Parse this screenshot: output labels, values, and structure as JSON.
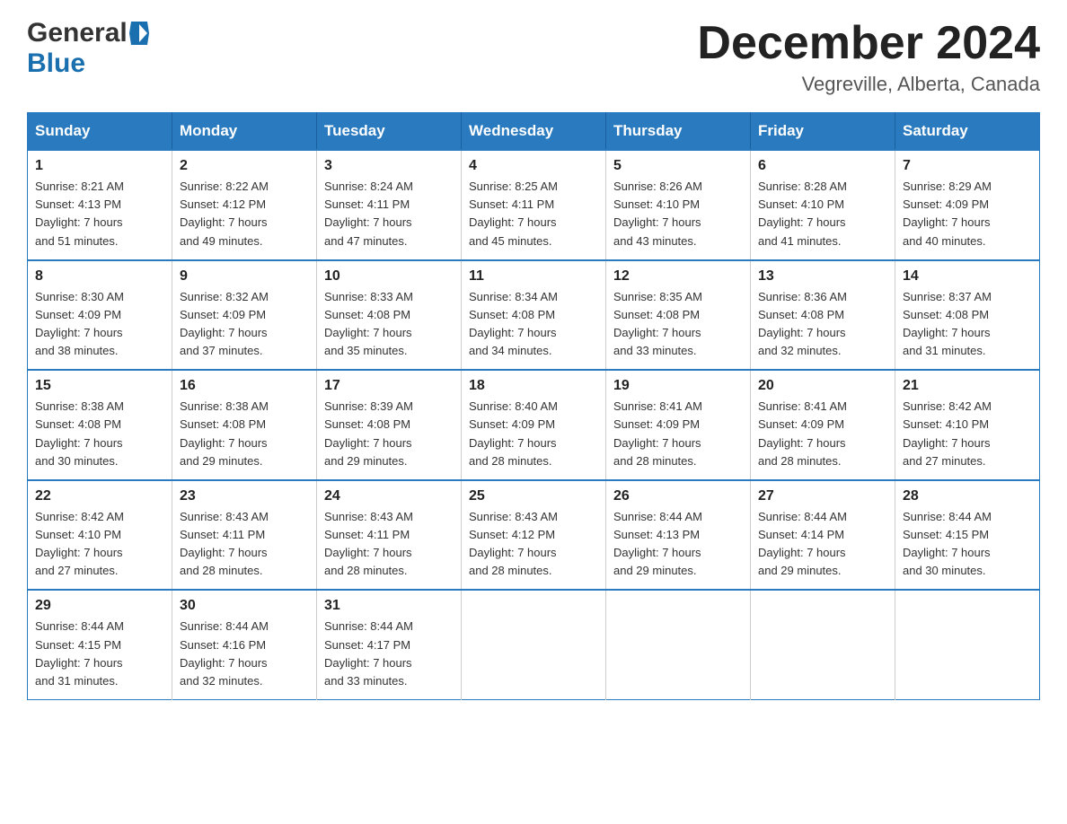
{
  "header": {
    "logo_general": "General",
    "logo_blue": "Blue",
    "month_title": "December 2024",
    "location": "Vegreville, Alberta, Canada"
  },
  "days_of_week": [
    "Sunday",
    "Monday",
    "Tuesday",
    "Wednesday",
    "Thursday",
    "Friday",
    "Saturday"
  ],
  "weeks": [
    [
      {
        "day": "1",
        "sunrise": "8:21 AM",
        "sunset": "4:13 PM",
        "daylight": "7 hours and 51 minutes."
      },
      {
        "day": "2",
        "sunrise": "8:22 AM",
        "sunset": "4:12 PM",
        "daylight": "7 hours and 49 minutes."
      },
      {
        "day": "3",
        "sunrise": "8:24 AM",
        "sunset": "4:11 PM",
        "daylight": "7 hours and 47 minutes."
      },
      {
        "day": "4",
        "sunrise": "8:25 AM",
        "sunset": "4:11 PM",
        "daylight": "7 hours and 45 minutes."
      },
      {
        "day": "5",
        "sunrise": "8:26 AM",
        "sunset": "4:10 PM",
        "daylight": "7 hours and 43 minutes."
      },
      {
        "day": "6",
        "sunrise": "8:28 AM",
        "sunset": "4:10 PM",
        "daylight": "7 hours and 41 minutes."
      },
      {
        "day": "7",
        "sunrise": "8:29 AM",
        "sunset": "4:09 PM",
        "daylight": "7 hours and 40 minutes."
      }
    ],
    [
      {
        "day": "8",
        "sunrise": "8:30 AM",
        "sunset": "4:09 PM",
        "daylight": "7 hours and 38 minutes."
      },
      {
        "day": "9",
        "sunrise": "8:32 AM",
        "sunset": "4:09 PM",
        "daylight": "7 hours and 37 minutes."
      },
      {
        "day": "10",
        "sunrise": "8:33 AM",
        "sunset": "4:08 PM",
        "daylight": "7 hours and 35 minutes."
      },
      {
        "day": "11",
        "sunrise": "8:34 AM",
        "sunset": "4:08 PM",
        "daylight": "7 hours and 34 minutes."
      },
      {
        "day": "12",
        "sunrise": "8:35 AM",
        "sunset": "4:08 PM",
        "daylight": "7 hours and 33 minutes."
      },
      {
        "day": "13",
        "sunrise": "8:36 AM",
        "sunset": "4:08 PM",
        "daylight": "7 hours and 32 minutes."
      },
      {
        "day": "14",
        "sunrise": "8:37 AM",
        "sunset": "4:08 PM",
        "daylight": "7 hours and 31 minutes."
      }
    ],
    [
      {
        "day": "15",
        "sunrise": "8:38 AM",
        "sunset": "4:08 PM",
        "daylight": "7 hours and 30 minutes."
      },
      {
        "day": "16",
        "sunrise": "8:38 AM",
        "sunset": "4:08 PM",
        "daylight": "7 hours and 29 minutes."
      },
      {
        "day": "17",
        "sunrise": "8:39 AM",
        "sunset": "4:08 PM",
        "daylight": "7 hours and 29 minutes."
      },
      {
        "day": "18",
        "sunrise": "8:40 AM",
        "sunset": "4:09 PM",
        "daylight": "7 hours and 28 minutes."
      },
      {
        "day": "19",
        "sunrise": "8:41 AM",
        "sunset": "4:09 PM",
        "daylight": "7 hours and 28 minutes."
      },
      {
        "day": "20",
        "sunrise": "8:41 AM",
        "sunset": "4:09 PM",
        "daylight": "7 hours and 28 minutes."
      },
      {
        "day": "21",
        "sunrise": "8:42 AM",
        "sunset": "4:10 PM",
        "daylight": "7 hours and 27 minutes."
      }
    ],
    [
      {
        "day": "22",
        "sunrise": "8:42 AM",
        "sunset": "4:10 PM",
        "daylight": "7 hours and 27 minutes."
      },
      {
        "day": "23",
        "sunrise": "8:43 AM",
        "sunset": "4:11 PM",
        "daylight": "7 hours and 28 minutes."
      },
      {
        "day": "24",
        "sunrise": "8:43 AM",
        "sunset": "4:11 PM",
        "daylight": "7 hours and 28 minutes."
      },
      {
        "day": "25",
        "sunrise": "8:43 AM",
        "sunset": "4:12 PM",
        "daylight": "7 hours and 28 minutes."
      },
      {
        "day": "26",
        "sunrise": "8:44 AM",
        "sunset": "4:13 PM",
        "daylight": "7 hours and 29 minutes."
      },
      {
        "day": "27",
        "sunrise": "8:44 AM",
        "sunset": "4:14 PM",
        "daylight": "7 hours and 29 minutes."
      },
      {
        "day": "28",
        "sunrise": "8:44 AM",
        "sunset": "4:15 PM",
        "daylight": "7 hours and 30 minutes."
      }
    ],
    [
      {
        "day": "29",
        "sunrise": "8:44 AM",
        "sunset": "4:15 PM",
        "daylight": "7 hours and 31 minutes."
      },
      {
        "day": "30",
        "sunrise": "8:44 AM",
        "sunset": "4:16 PM",
        "daylight": "7 hours and 32 minutes."
      },
      {
        "day": "31",
        "sunrise": "8:44 AM",
        "sunset": "4:17 PM",
        "daylight": "7 hours and 33 minutes."
      },
      null,
      null,
      null,
      null
    ]
  ],
  "labels": {
    "sunrise": "Sunrise:",
    "sunset": "Sunset:",
    "daylight": "Daylight:"
  }
}
